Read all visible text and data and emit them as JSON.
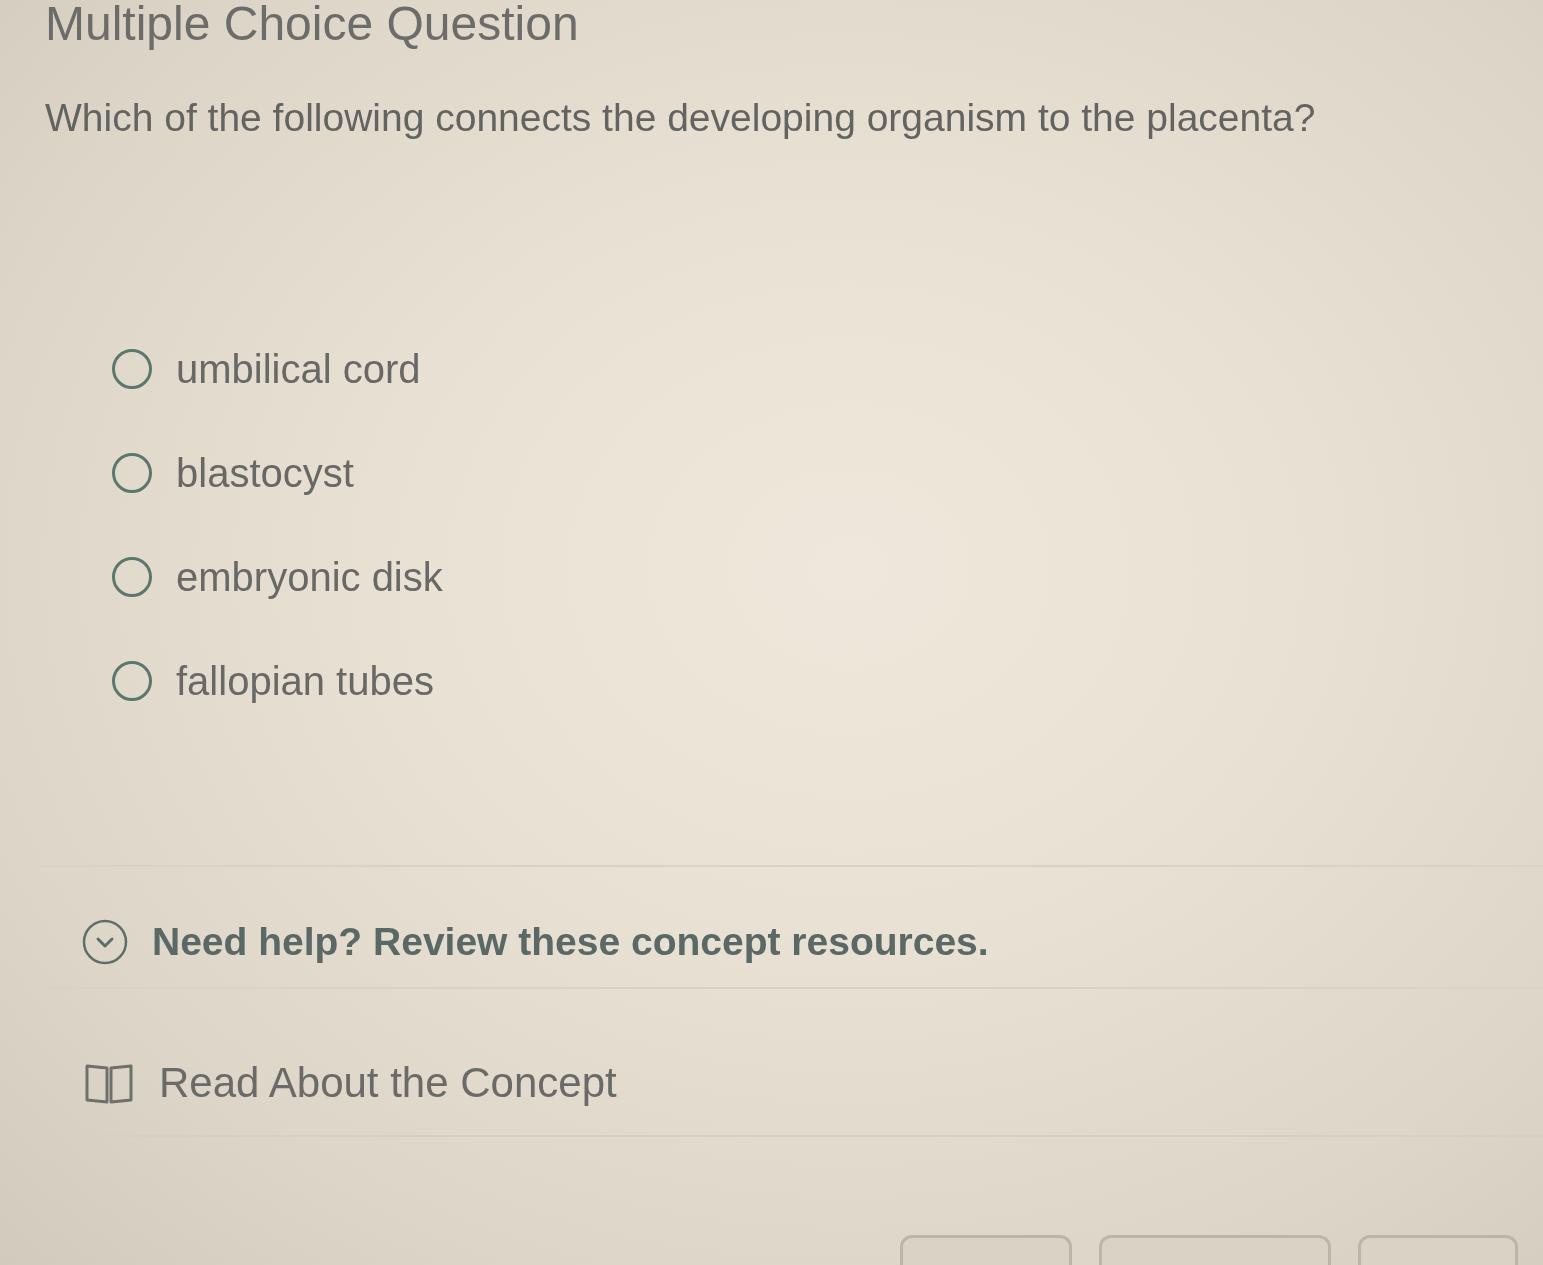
{
  "header": {
    "title": "Multiple Choice Question"
  },
  "question": {
    "prompt": "Which of the following connects the developing organism to the placenta?",
    "options": [
      {
        "label": "umbilical cord",
        "selected": false
      },
      {
        "label": "blastocyst",
        "selected": false
      },
      {
        "label": "embryonic disk",
        "selected": false
      },
      {
        "label": "fallopian tubes",
        "selected": false
      }
    ]
  },
  "help": {
    "label": "Need help? Review these concept resources.",
    "expanded": true,
    "resources": [
      {
        "kind": "reading",
        "label": "Read About the Concept"
      }
    ]
  },
  "footer": {
    "buttons": [
      {
        "kind": "outline"
      },
      {
        "kind": "outline"
      },
      {
        "kind": "outline"
      }
    ]
  }
}
